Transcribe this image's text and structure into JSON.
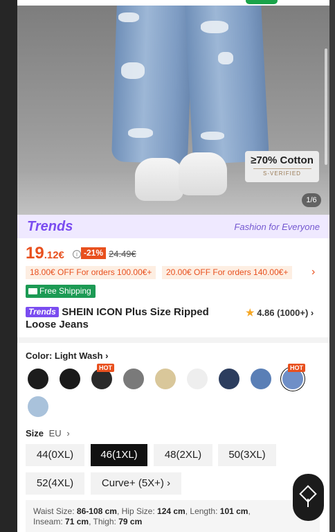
{
  "gallery": {
    "counter": "1/6",
    "badge_main": "≥70% Cotton",
    "badge_sub": "S-VERIFIED"
  },
  "banner": {
    "logo": "Trends",
    "slogan": "Fashion for Everyone"
  },
  "price": {
    "integer": "19",
    "decimal": ".12€",
    "discount": "-21%",
    "original": "24.49€"
  },
  "coupons": [
    {
      "label": "18.00€ OFF For orders 100.00€+"
    },
    {
      "label": "20.00€ OFF For orders 140.00€+"
    }
  ],
  "shipping": {
    "label": "Free Shipping"
  },
  "product": {
    "tag": "Trends",
    "title": "SHEIN ICON Plus Size Ripped Loose Jeans",
    "rating": "4.86",
    "reviews": "(1000+)"
  },
  "color": {
    "label": "Color: Light Wash"
  },
  "swatch_colors": [
    "#1c1c1c",
    "#1a1a1a",
    "#2a2a2a",
    "#7a7a7a",
    "#d9c79a",
    "#eeeeee",
    "#2c3d5e",
    "#5a7fb6",
    "#6f8fc7",
    "#a9c2db"
  ],
  "hot_label": "HOT",
  "size": {
    "label": "Size",
    "unit": "EU",
    "options": [
      "44(0XL)",
      "46(1XL)",
      "48(2XL)",
      "50(3XL)",
      "52(4XL)",
      "Curve+ (5X+)"
    ],
    "selected": "46(1XL)"
  },
  "measurements": {
    "waist_label": "Waist Size:",
    "waist": "86-108 cm",
    "hip_label": "Hip Size:",
    "hip": "124 cm",
    "length_label": "Length:",
    "length": "101 cm",
    "inseam_label": "Inseam:",
    "inseam": "71 cm",
    "thigh_label": "Thigh:",
    "thigh": "79 cm"
  }
}
